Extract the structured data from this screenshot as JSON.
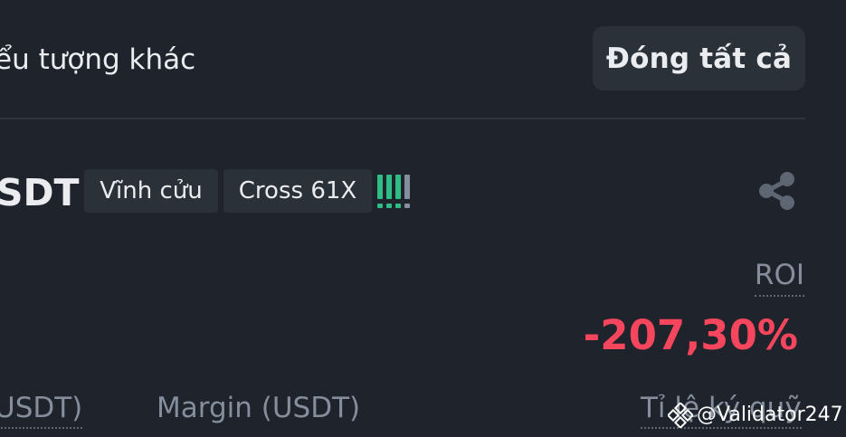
{
  "header": {
    "text": "ểu tượng khác",
    "close_all_label": "Đóng tất cả"
  },
  "position": {
    "symbol": "SDT",
    "type_tag": "Vĩnh cửu",
    "leverage_tag": "Cross 61X",
    "risk_level": {
      "filled": 3,
      "total": 4
    },
    "share_icon": "share-icon"
  },
  "roi": {
    "label": "ROI",
    "value": "-207,30%"
  },
  "columns": {
    "col1": "USDT)",
    "col2": "Margin (USDT)",
    "col3": "Tỉ lệ ký quỹ"
  },
  "watermark": {
    "text": "@Validator247",
    "icon": "binance-logo-icon"
  },
  "colors": {
    "background": "#1f232b",
    "negative": "#f6465d",
    "positive": "#2ebd85",
    "muted": "#848e9c"
  }
}
